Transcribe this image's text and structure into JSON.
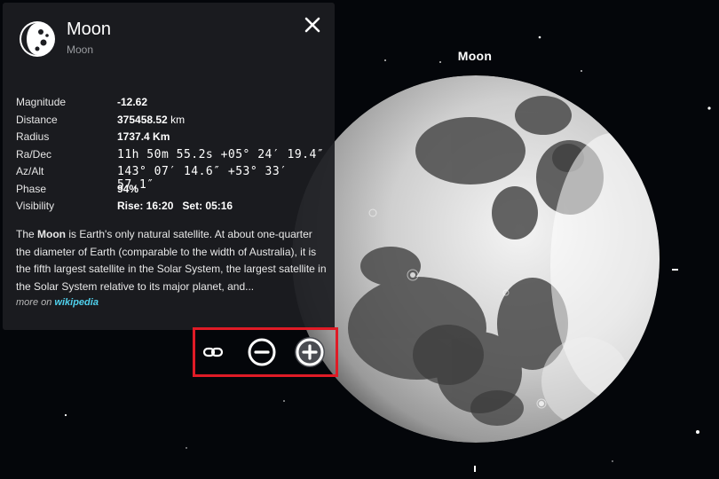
{
  "sky": {
    "object_label": "Moon"
  },
  "info_panel": {
    "title": "Moon",
    "subtitle": "Moon",
    "icon": "moon-phase-icon",
    "close_icon": "close-icon",
    "rows": {
      "magnitude": {
        "label": "Magnitude",
        "value": "-12.62"
      },
      "distance": {
        "label": "Distance",
        "value": "375458.52",
        "unit": "km"
      },
      "radius": {
        "label": "Radius",
        "value": "1737.4 Km"
      },
      "radec": {
        "label": "Ra/Dec",
        "value": "11h 50m 55.2s  +05° 24′ 19.4″"
      },
      "azalt": {
        "label": "Az/Alt",
        "value": "143° 07′ 14.6″  +53° 33′ 57.1″"
      },
      "phase": {
        "label": "Phase",
        "value": "94%"
      },
      "visibility": {
        "label": "Visibility",
        "rise": "Rise: 16:20",
        "set": "Set: 05:16"
      }
    },
    "description": {
      "bold": "Moon",
      "pre": "The ",
      "post": " is Earth's only natural satellite. At about one-quarter the diameter of Earth (comparable to the width of Australia), it is the fifth largest satellite in the Solar System, the largest satellite in the Solar System relative to its major planet, and..."
    },
    "more_on": "more on",
    "more_link": "wikipedia"
  },
  "toolbar": {
    "link_icon": "link-icon",
    "zoom_out_icon": "zoom-out-icon",
    "zoom_in_icon": "zoom-in-icon",
    "highlight_color": "#e01b26"
  }
}
